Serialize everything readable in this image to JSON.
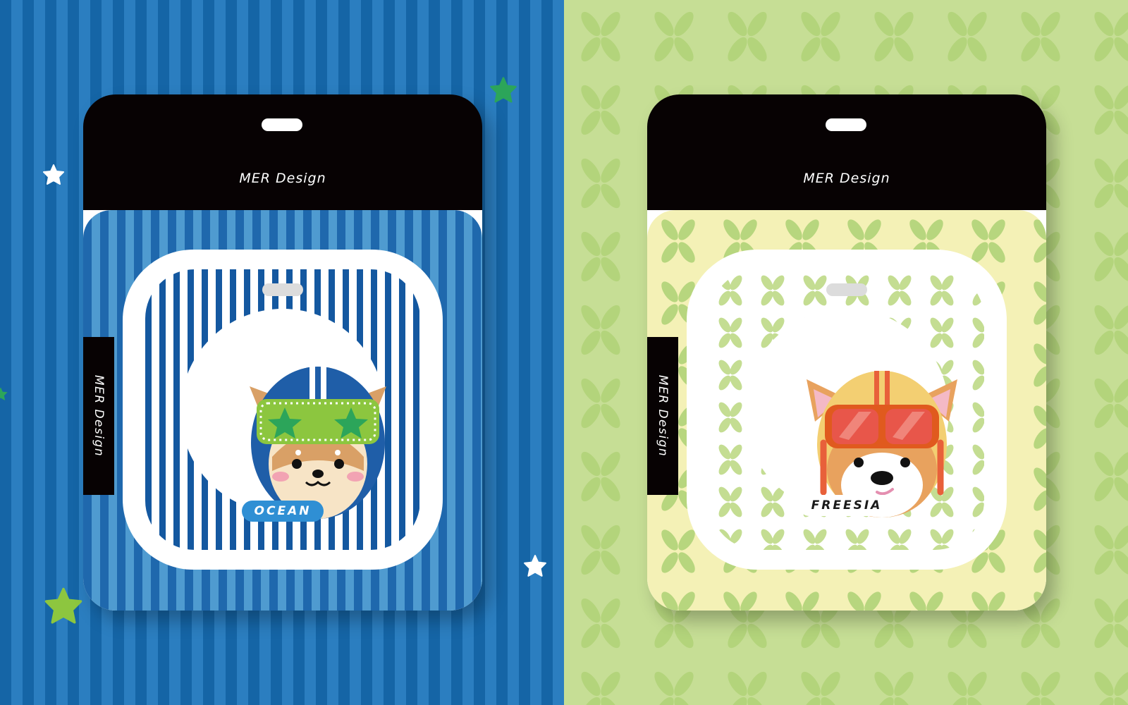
{
  "colors": {
    "blue_stripe_dark": "#1565a6",
    "blue_stripe_light": "#2b7ec0",
    "green_bg": "#c6de95",
    "header_black": "#070203",
    "star_green": "#2ca55a",
    "star_lime": "#8dc63f",
    "label_blue": "#2f8fd4"
  },
  "badges": [
    {
      "theme": "blue-stripes",
      "header_text": "MER Design",
      "side_text": "MER Design",
      "name": "OCEAN",
      "mascot_icon": "shiba-dog-blue-helmet-green-star-goggles-icon"
    },
    {
      "theme": "yellow-leaves",
      "header_text": "MER Design",
      "side_text": "MER Design",
      "name": "FREESIA",
      "mascot_icon": "corgi-dog-yellow-helmet-red-goggles-icon"
    }
  ],
  "decorations": {
    "stars": [
      "white-star-icon",
      "green-star-icon",
      "lime-star-icon"
    ]
  }
}
